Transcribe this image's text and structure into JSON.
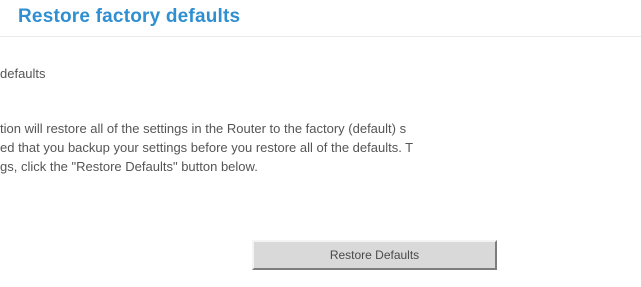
{
  "page": {
    "title": "Restore factory defaults",
    "subheading": "defaults",
    "description_lines": [
      "tion will restore all of the settings in the Router to the factory (default) s",
      "ed that you backup your settings before you restore all of the defaults. T",
      "gs, click the \"Restore Defaults\" button below."
    ]
  },
  "actions": {
    "restore_label": "Restore Defaults"
  },
  "colors": {
    "title": "#2f8fd1",
    "body_text": "#555555",
    "button_face": "#d9d9d9"
  }
}
